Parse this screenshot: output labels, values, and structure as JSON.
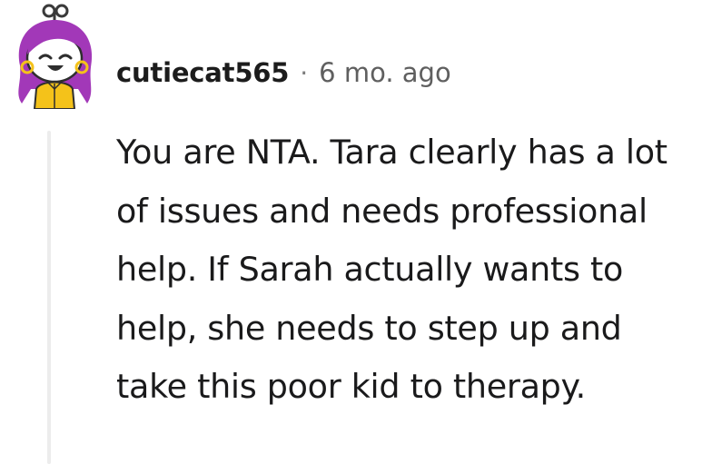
{
  "comment": {
    "avatar_icon": "user-avatar-snoo-purple-hair-icon",
    "username": "cutiecat565",
    "separator": "·",
    "timestamp": "6 mo. ago",
    "body": "You are NTA. Tara clearly has a lot of issues and needs professional help. If Sarah actually wants to help, she needs to step up and take this poor kid to therapy."
  },
  "colors": {
    "hair": "#a238b8",
    "jacket": "#f4c21a",
    "thread_line": "#ececec",
    "text": "#1a1a1b",
    "meta": "#5f5f5f"
  }
}
